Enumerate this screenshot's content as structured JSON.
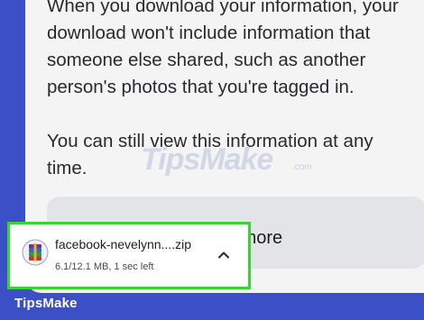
{
  "content": {
    "paragraph_1": "When you download your information, your download won't include information that someone else shared, such as another person's photos that you're tagged in.",
    "paragraph_2": "You can still view this information at any time.",
    "learn_more_label": "Learn more"
  },
  "download": {
    "file_name": "facebook-nevelynn....zip",
    "status": "6.1/12.1 MB, 1 sec left",
    "file_icon": "winrar-archive-icon",
    "expand_icon": "chevron-up-icon"
  },
  "watermark": {
    "text": "TipsMake",
    "sub": ".com"
  },
  "brand": {
    "label": "TipsMake"
  },
  "colors": {
    "background": "#3b4fc7",
    "panel": "#f4f4f5",
    "highlight": "#35d62f",
    "button": "#e3e4e7"
  }
}
